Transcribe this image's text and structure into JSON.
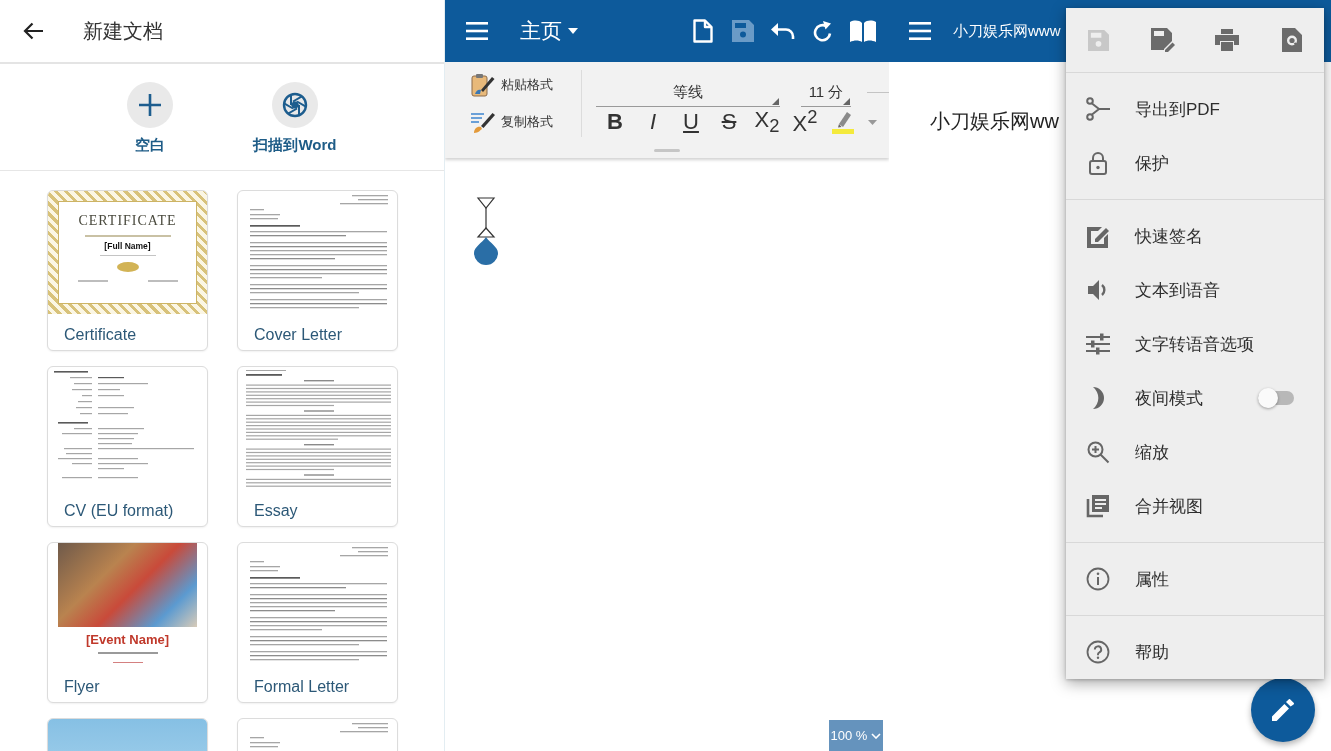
{
  "new_document": {
    "title": "新建文档",
    "actions": [
      {
        "kind": "blank",
        "label": "空白"
      },
      {
        "kind": "scan",
        "label": "扫描到Word"
      }
    ],
    "templates": [
      {
        "kind": "certificate",
        "name": "Certificate",
        "preview_heading": "CERTIFICATE",
        "preview_name": "[Full Name]"
      },
      {
        "kind": "letter",
        "name": "Cover Letter"
      },
      {
        "kind": "cv",
        "name": "CV (EU format)"
      },
      {
        "kind": "essay",
        "name": "Essay"
      },
      {
        "kind": "flyer",
        "name": "Flyer",
        "preview_heading": "[Event Name]"
      },
      {
        "kind": "letter",
        "name": "Formal Letter"
      },
      {
        "kind": "photo"
      },
      {
        "kind": "letter"
      }
    ]
  },
  "editor": {
    "tab": "主页",
    "toolbar": [
      {
        "kind": "new",
        "disabled": false
      },
      {
        "kind": "save",
        "disabled": true
      },
      {
        "kind": "undo",
        "disabled": false
      },
      {
        "kind": "redo",
        "disabled": false
      },
      {
        "kind": "read",
        "disabled": false
      }
    ],
    "format_painter": [
      {
        "kind": "paste",
        "label": "粘贴格式"
      },
      {
        "kind": "copy",
        "label": "复制格式"
      }
    ],
    "font": "等线",
    "font_size": "11 分",
    "format_buttons": [
      {
        "kind": "bold",
        "label": "B"
      },
      {
        "kind": "italic",
        "label": "I"
      },
      {
        "kind": "underline",
        "label": "U"
      },
      {
        "kind": "strike",
        "label": "S"
      },
      {
        "kind": "subscript",
        "label": "X$_{2}$"
      },
      {
        "kind": "superscript",
        "label": "X$^{2}$"
      }
    ],
    "zoom": "100 %"
  },
  "viewer": {
    "title": "小刀娱乐网www",
    "body_text": "小刀娱乐网ww",
    "menu": {
      "icons": [
        {
          "kind": "save",
          "disabled": true
        },
        {
          "kind": "save-as",
          "disabled": false
        },
        {
          "kind": "print",
          "disabled": false
        },
        {
          "kind": "preview",
          "disabled": false
        }
      ],
      "sections": [
        {
          "items": [
            {
              "kind": "pdf",
              "label": "导出到PDF"
            },
            {
              "kind": "protect",
              "label": "保护"
            }
          ]
        },
        {
          "items": [
            {
              "kind": "sign",
              "label": "快速签名"
            },
            {
              "kind": "speak",
              "label": "文本到语音"
            },
            {
              "kind": "speech-options",
              "label": "文字转语音选项"
            },
            {
              "kind": "night",
              "label": "夜间模式",
              "on": false
            },
            {
              "kind": "zoom",
              "label": "缩放"
            },
            {
              "kind": "merge",
              "label": "合并视图"
            }
          ]
        },
        {
          "items": [
            {
              "kind": "info",
              "label": "属性"
            }
          ]
        },
        {
          "items": [
            {
              "kind": "help",
              "label": "帮助"
            }
          ]
        }
      ]
    }
  }
}
